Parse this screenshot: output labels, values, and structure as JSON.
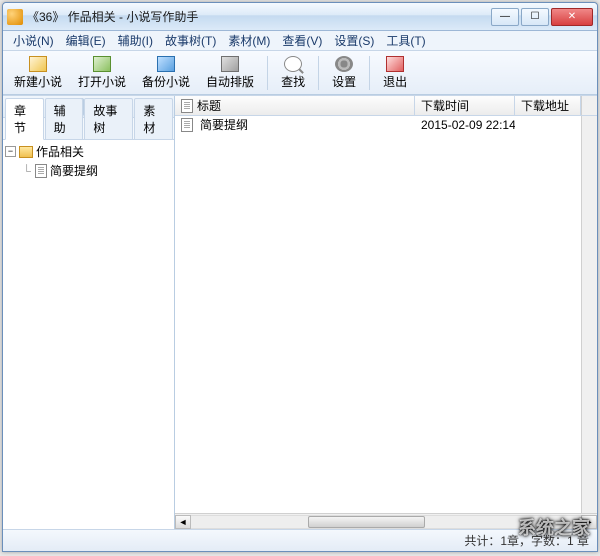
{
  "window": {
    "title": "《36》 作品相关 - 小说写作助手"
  },
  "menu": {
    "items": [
      "小说(N)",
      "编辑(E)",
      "辅助(I)",
      "故事树(T)",
      "素材(M)",
      "查看(V)",
      "设置(S)",
      "工具(T)"
    ]
  },
  "toolbar": {
    "new_label": "新建小说",
    "open_label": "打开小说",
    "backup_label": "备份小说",
    "auto_label": "自动排版",
    "find_label": "查找",
    "settings_label": "设置",
    "exit_label": "退出"
  },
  "left_tabs": {
    "items": [
      "章节",
      "辅助",
      "故事树",
      "素材"
    ],
    "active_index": 0
  },
  "tree": {
    "root": {
      "label": "作品相关",
      "children": [
        {
          "label": "简要提纲"
        }
      ]
    }
  },
  "list": {
    "columns": [
      "标题",
      "下载时间",
      "下载地址"
    ],
    "rows": [
      {
        "title": "简要提纲",
        "time": "2015-02-09 22:14",
        "url": ""
      }
    ]
  },
  "status": {
    "text": "共计：1章，字数：1 章"
  },
  "watermark": "系统之家"
}
